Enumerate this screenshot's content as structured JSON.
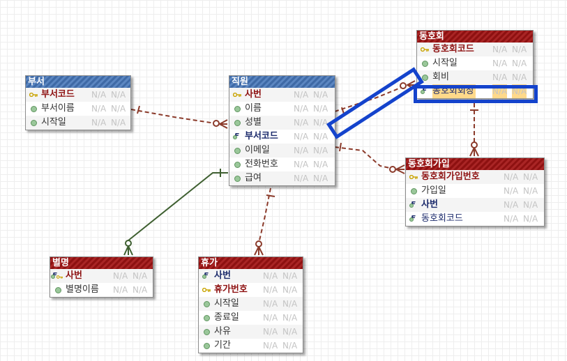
{
  "na_text": "N/A",
  "entities": {
    "buseo": {
      "title": "부서",
      "columns": [
        {
          "name": "부서코드",
          "type": "pk"
        },
        {
          "name": "부서이름",
          "type": "attr"
        },
        {
          "name": "시작일",
          "type": "attr"
        }
      ]
    },
    "jigwon": {
      "title": "직원",
      "columns": [
        {
          "name": "사번",
          "type": "pk"
        },
        {
          "name": "이름",
          "type": "attr"
        },
        {
          "name": "성별",
          "type": "attr"
        },
        {
          "name": "부서코드",
          "type": "fk"
        },
        {
          "name": "이메일",
          "type": "attr"
        },
        {
          "name": "전화번호",
          "type": "attr"
        },
        {
          "name": "급여",
          "type": "attr"
        }
      ]
    },
    "donghohoe": {
      "title": "동호회",
      "columns": [
        {
          "name": "동호회코드",
          "type": "pk"
        },
        {
          "name": "시작일",
          "type": "attr"
        },
        {
          "name": "회비",
          "type": "attr"
        },
        {
          "name": "동호회회장",
          "type": "fk"
        }
      ]
    },
    "donghohoe_gaip": {
      "title": "동호회가입",
      "columns": [
        {
          "name": "동호회가입번호",
          "type": "pk"
        },
        {
          "name": "가입일",
          "type": "attr"
        },
        {
          "name": "사번",
          "type": "fk"
        },
        {
          "name": "동호회코드",
          "type": "fk"
        }
      ]
    },
    "byeolmyeong": {
      "title": "별명",
      "columns": [
        {
          "name": "사번",
          "type": "pkfk"
        },
        {
          "name": "별명이름",
          "type": "attr"
        }
      ]
    },
    "hyuga": {
      "title": "휴가",
      "columns": [
        {
          "name": "사번",
          "type": "fk"
        },
        {
          "name": "휴가번호",
          "type": "pk"
        },
        {
          "name": "시작일",
          "type": "attr"
        },
        {
          "name": "종료일",
          "type": "attr"
        },
        {
          "name": "사유",
          "type": "attr"
        },
        {
          "name": "기간",
          "type": "attr"
        }
      ]
    }
  },
  "relationships": [
    {
      "from": "부서",
      "to": "직원",
      "style": "dashed",
      "color": "#8b3a2a"
    },
    {
      "from": "직원",
      "to": "동호회",
      "style": "dashed",
      "color": "#8b3a2a"
    },
    {
      "from": "직원",
      "to": "동호회가입",
      "style": "dashed",
      "color": "#8b3a2a"
    },
    {
      "from": "동호회",
      "to": "동호회가입",
      "style": "dashed",
      "color": "#8b3a2a"
    },
    {
      "from": "직원",
      "to": "휴가",
      "style": "dashed",
      "color": "#8b3a2a"
    },
    {
      "from": "직원",
      "to": "별명",
      "style": "solid",
      "color": "#3e5f30"
    }
  ],
  "highlight_color": "#1443cc",
  "highlighted_column": "동호회회장"
}
